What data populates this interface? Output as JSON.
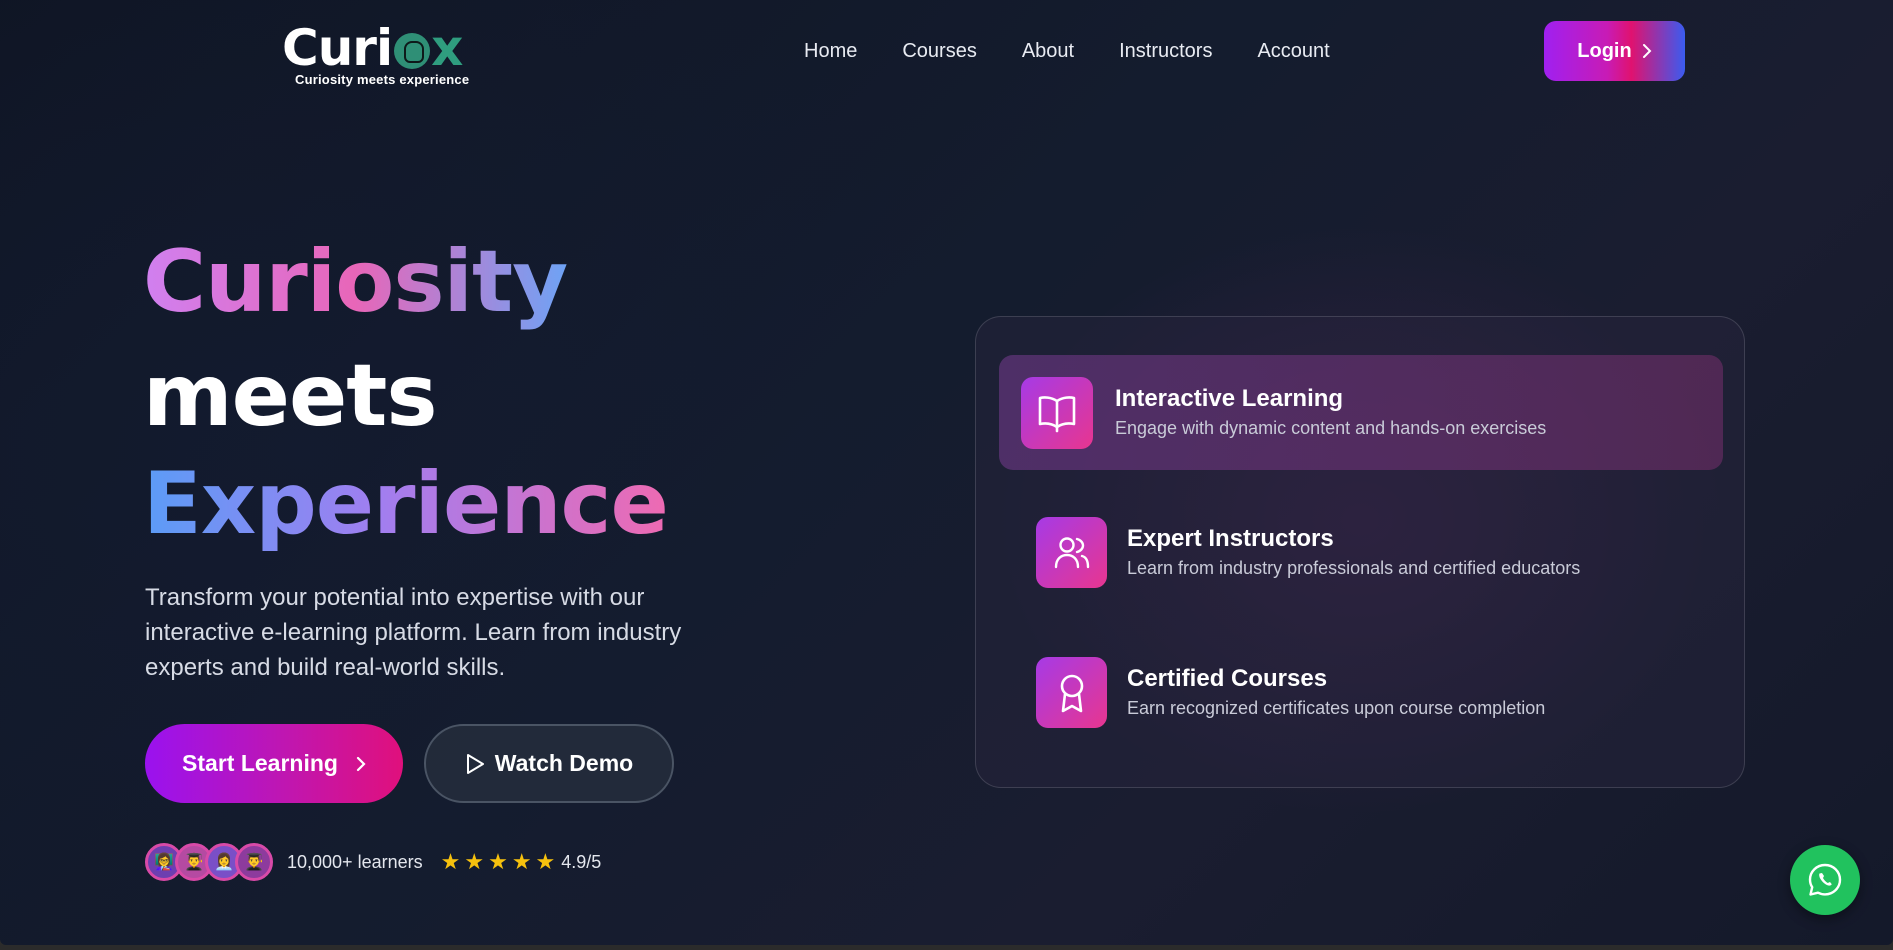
{
  "brand": {
    "logo_text_a": "Curi",
    "logo_text_b": "x",
    "tagline": "Curiosity meets experience"
  },
  "nav": {
    "items": [
      "Home",
      "Courses",
      "About",
      "Instructors",
      "Account"
    ],
    "login_label": "Login"
  },
  "hero": {
    "line1": "Curiosity",
    "line2": "meets",
    "line3": "Experience",
    "description": "Transform your potential into expertise with our interactive e-learning platform. Learn from industry experts and build real-world skills.",
    "start_label": "Start Learning",
    "demo_label": "Watch Demo",
    "learners": "10,000+ learners",
    "rating": "4.9/5",
    "stars": 5
  },
  "features": [
    {
      "title": "Interactive Learning",
      "desc": "Engage with dynamic content and hands-on exercises",
      "icon": "book-icon"
    },
    {
      "title": "Expert Instructors",
      "desc": "Learn from industry professionals and certified educators",
      "icon": "users-icon"
    },
    {
      "title": "Certified Courses",
      "desc": "Earn recognized certificates upon course completion",
      "icon": "award-icon"
    }
  ],
  "colors": {
    "accent_purple": "#9a12ef",
    "accent_pink": "#e0107c",
    "whatsapp": "#21c25e",
    "star": "#f6c10e"
  }
}
